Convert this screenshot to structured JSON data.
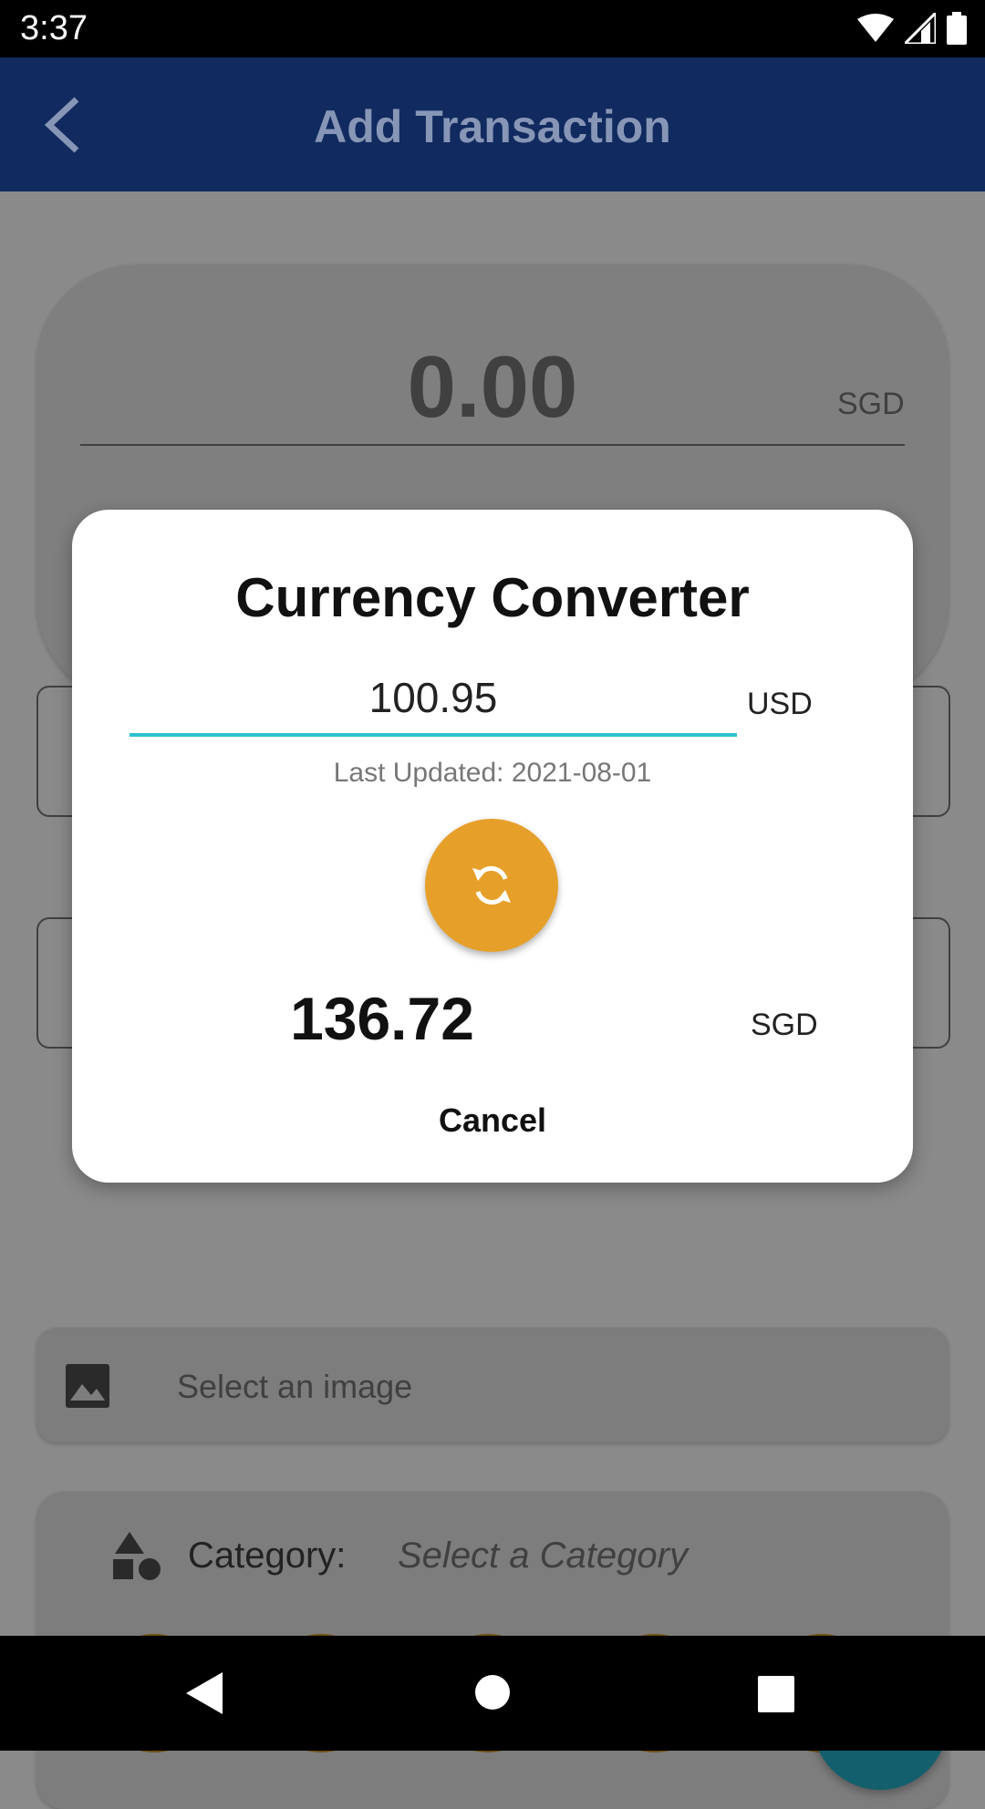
{
  "status_bar": {
    "time": "3:37",
    "icons": [
      "wifi-icon",
      "signal-icon",
      "battery-icon"
    ]
  },
  "app_bar": {
    "title": "Add Transaction",
    "back_icon": "back-arrow-icon"
  },
  "amount": {
    "value": "0.00",
    "currency": "SGD"
  },
  "image_field": {
    "placeholder": "Select an image",
    "icon": "image-icon"
  },
  "category": {
    "label": "Category:",
    "placeholder": "Select a Category",
    "icon": "category-shapes-icon",
    "buttons": [
      "shopping-bag-icon",
      "fast-food-icon",
      "gamepad-icon",
      "entertainment-icon",
      "transport-icon"
    ]
  },
  "save_fab": {
    "icon": "save-icon"
  },
  "dialog": {
    "title": "Currency Converter",
    "input_value": "100.95",
    "from_currency": "USD",
    "last_updated": "Last Updated: 2021-08-01",
    "swap_icon": "swap-icon",
    "result": "136.72",
    "to_currency": "SGD",
    "cancel_label": "Cancel"
  },
  "colors": {
    "accent": "#2bc1d3",
    "swap_button": "#e6a02a",
    "app_bar": "#112a5f"
  }
}
